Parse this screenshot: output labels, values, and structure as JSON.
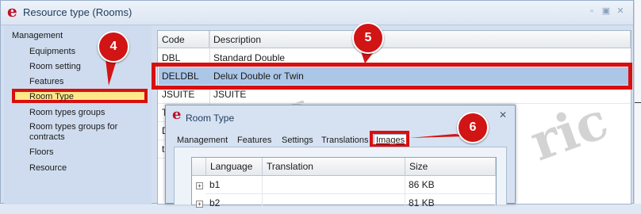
{
  "window": {
    "title": "Resource type (Rooms)"
  },
  "sidebar": {
    "items": [
      {
        "label": "Management"
      },
      {
        "label": "Equipments"
      },
      {
        "label": "Room setting"
      },
      {
        "label": "Features"
      },
      {
        "label": "Room Type",
        "selected": true
      },
      {
        "label": "Room types groups"
      },
      {
        "label": "Room types groups for contracts"
      },
      {
        "label": "Floors"
      },
      {
        "label": "Resource"
      }
    ]
  },
  "grid": {
    "columns": [
      "Code",
      "Description"
    ],
    "rows": [
      {
        "code": "DBL",
        "description": "Standard Double"
      },
      {
        "code": "DELDBL",
        "description": "Delux Double or Twin"
      },
      {
        "code": "JSUITE",
        "description": "JSUITE"
      },
      {
        "code": "T",
        "description": ""
      },
      {
        "code": "D",
        "description": ""
      },
      {
        "code": "tl",
        "description": ""
      }
    ],
    "selected_row": 1
  },
  "dialog": {
    "title": "Room Type",
    "tabs": [
      "Management",
      "Features",
      "Settings",
      "Translations",
      "Images"
    ],
    "active_tab": "Images",
    "table": {
      "columns": [
        "Language",
        "Translation",
        "Size"
      ],
      "rows": [
        {
          "language": "b1",
          "translation": "",
          "size": "86 KB"
        },
        {
          "language": "b2",
          "translation": "",
          "size": "81 KB"
        }
      ]
    }
  },
  "callouts": [
    "4",
    "5",
    "6"
  ],
  "icons": {
    "app": "e",
    "expand": "+"
  },
  "colors": {
    "highlight_red": "#d90f0f",
    "selection_blue": "#abc6e7",
    "selected_nav": "#ffe88a",
    "brand": "#c0102a"
  }
}
